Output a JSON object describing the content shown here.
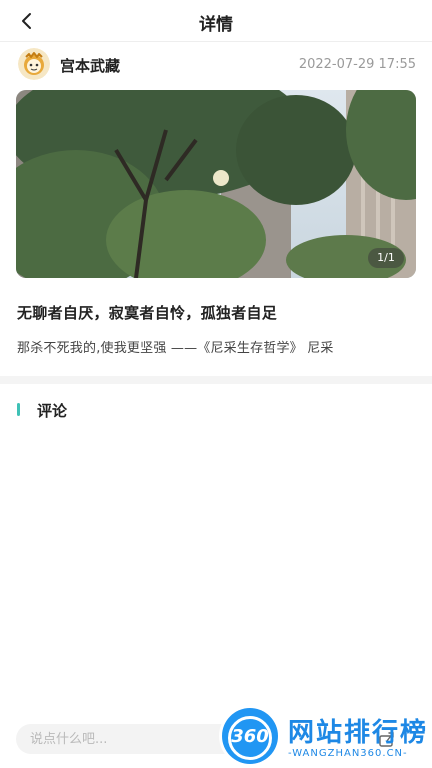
{
  "header": {
    "title": "详情",
    "back_icon": "chevron-left-icon"
  },
  "post": {
    "author": "宫本武藏",
    "time": "2022-07-29 17:55",
    "image_counter": "1/1",
    "title": "无聊者自厌，寂寞者自怜，孤独者自足",
    "body": "那杀不死我的,使我更坚强 ——《尼采生存哲学》 尼采"
  },
  "comments": {
    "section_label": "评论",
    "accent_color": "#3fc1b6"
  },
  "comment_bar": {
    "placeholder": "说点什么吧...",
    "share_icon": "share-icon"
  },
  "watermark": {
    "badge": "360",
    "title": "网站排行榜",
    "url": "-WANGZHAN360.CN-"
  }
}
